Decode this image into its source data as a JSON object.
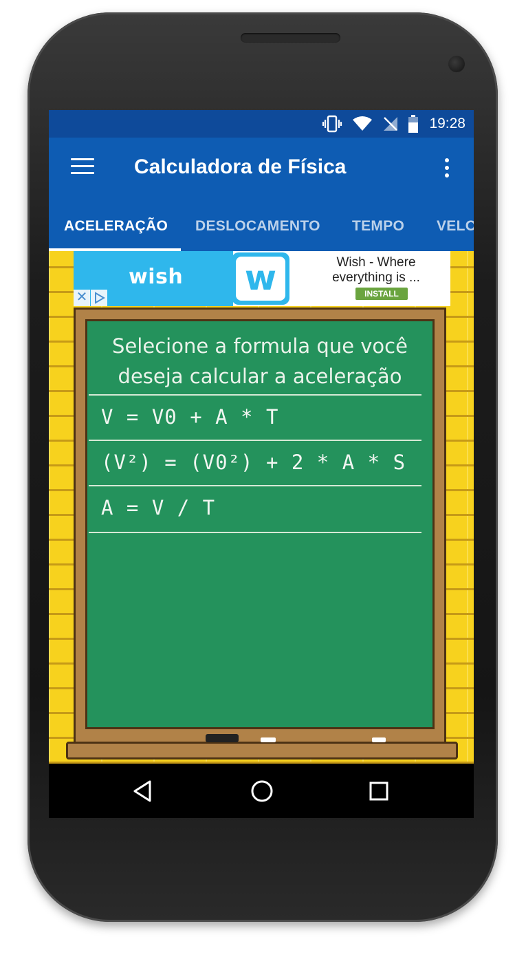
{
  "status_bar": {
    "time": "19:28",
    "icons": [
      "vibrate-icon",
      "wifi-icon",
      "no-signal-icon",
      "battery-icon"
    ]
  },
  "app_bar": {
    "title": "Calculadora de Física",
    "menu_icon": "hamburger-menu-icon",
    "overflow_icon": "more-vert-icon"
  },
  "tabs": [
    {
      "label": "ACELERAÇÃO",
      "active": true
    },
    {
      "label": "DESLOCAMENTO",
      "active": false
    },
    {
      "label": "TEMPO",
      "active": false
    },
    {
      "label": "VELO",
      "active": false
    }
  ],
  "ad": {
    "brand_word": "wish",
    "logo_letter": "w",
    "headline": "Wish - Where everything is ...",
    "install_label": "INSTALL",
    "close_glyph": "✕"
  },
  "board": {
    "prompt": "Selecione a formula que você deseja calcular a aceleração",
    "formulas": [
      "V = V0 + A * T",
      "(V²) = (V0²) + 2 * A * S",
      "A = V / T"
    ]
  },
  "navigation": {
    "buttons": [
      "back-icon",
      "home-icon",
      "recents-icon"
    ]
  },
  "colors": {
    "status_bar": "#0e4a9a",
    "app_bar": "#0e5cb3",
    "board_green": "#24925c",
    "wall_yellow": "#f7d21e",
    "wish_blue": "#2fb7ec"
  }
}
